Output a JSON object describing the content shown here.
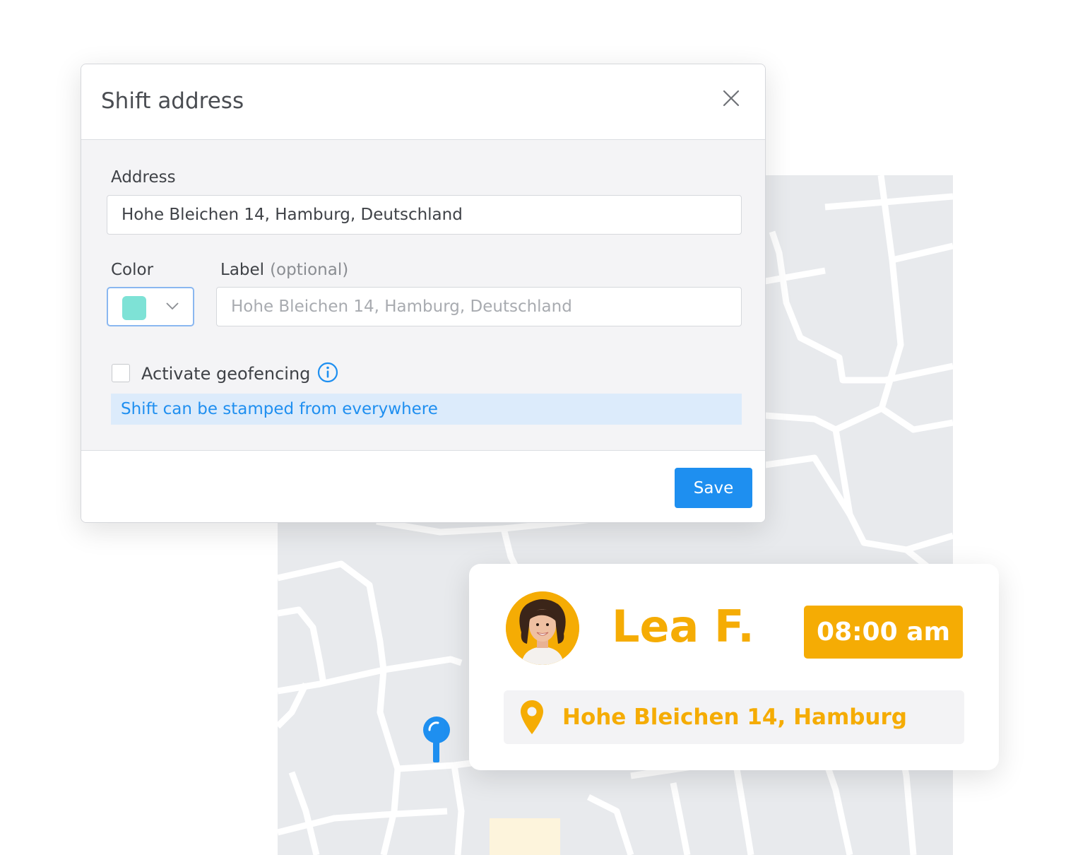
{
  "modal": {
    "title": "Shift address",
    "close_icon": "close-icon",
    "address_label": "Address",
    "address_value": "Hohe Bleichen 14, Hamburg, Deutschland",
    "color_label": "Color",
    "color_value": "#7ee2d6",
    "label_label": "Label",
    "label_optional": "(optional)",
    "label_placeholder": "Hohe Bleichen 14, Hamburg, Deutschland",
    "geofencing_label": "Activate geofencing",
    "geofencing_checked": false,
    "info_icon": "info-icon",
    "geofencing_note": "Shift can be stamped from everywhere",
    "save_label": "Save"
  },
  "card": {
    "name": "Lea F.",
    "time": "08:00 am",
    "address": "Hohe Bleichen 14, Hamburg",
    "location_icon": "map-pin-icon"
  },
  "colors": {
    "accent": "#1e8ff0",
    "highlight": "#f5ac04",
    "map_background": "#e8eaed"
  }
}
